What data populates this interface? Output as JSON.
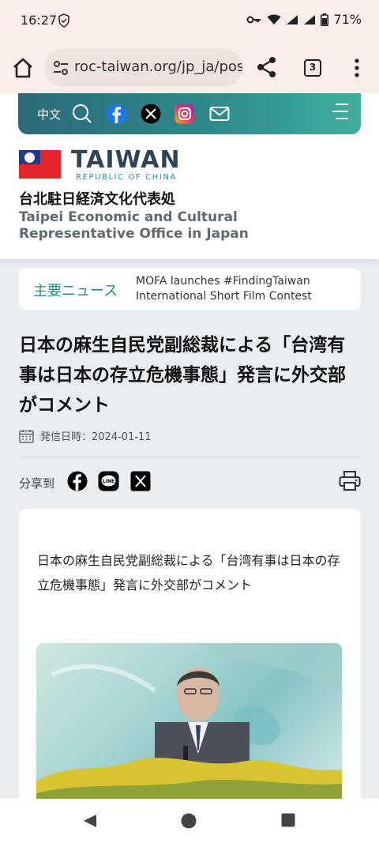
{
  "status": {
    "time": "16:27",
    "battery": "71%"
  },
  "browser": {
    "url": "roc-taiwan.org/jp_ja/pos",
    "tab_count": "3"
  },
  "site": {
    "lang_switch": "中文",
    "logo_word": "TAIWAN",
    "logo_sub": "REPUBLIC OF CHINA",
    "office_jp": "台北駐日経済文化代表処",
    "office_en": "Taipei Economic and Cultural Representative Office in Japan",
    "icons": [
      "search-icon",
      "facebook-icon",
      "x-icon",
      "instagram-icon",
      "mail-icon",
      "menu-icon"
    ]
  },
  "news": {
    "label": "主要ニュース",
    "headline": "MOFA launches #FindingTaiwan International Short Film Contest"
  },
  "article": {
    "title": "日本の麻生自民党副総裁による「台湾有事は日本の存立危機事態」発言に外交部がコメント",
    "date": "発信日時：2024-01-11",
    "share_label": "分享到",
    "lead": "日本の麻生自民党副総裁による「台湾有事は日本の存立危機事態」発言に外交部がコメント"
  },
  "colors": {
    "accent": "#2a8a8a",
    "toolbar_start": "#2b6a7a",
    "toolbar_end": "#3fae9e"
  }
}
